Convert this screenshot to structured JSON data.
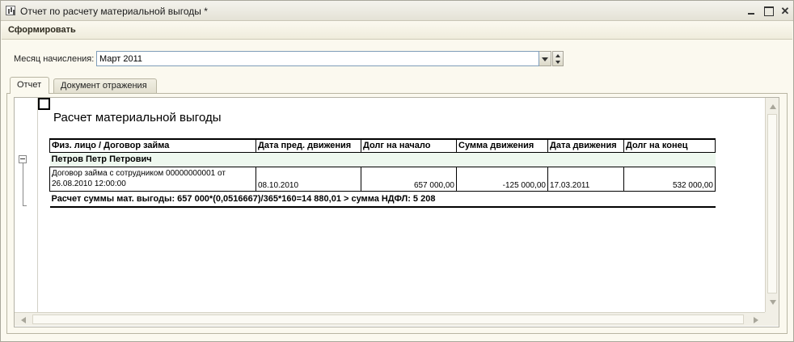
{
  "window": {
    "title": "Отчет по расчету материальной выгоды *"
  },
  "toolbar": {
    "generate_label": "Сформировать"
  },
  "filter": {
    "month_label": "Месяц начисления:",
    "month_value": "Март 2011"
  },
  "tabs": [
    {
      "label": "Отчет",
      "active": true
    },
    {
      "label": "Документ отражения",
      "active": false
    }
  ],
  "report": {
    "title": "Расчет материальной выгоды",
    "columns": [
      "Физ. лицо / Договор займа",
      "Дата пред. движения",
      "Долг на начало",
      "Сумма движения",
      "Дата движения",
      "Долг на конец"
    ],
    "person": "Петров Петр Петрович",
    "row": {
      "contract": "Договор займа с сотрудником 00000000001 от 26.08.2010 12:00:00",
      "prev_date": "08.10.2010",
      "debt_start": "657 000,00",
      "movement_sum": "-125 000,00",
      "movement_date": "17.03.2011",
      "debt_end": "532 000,00"
    },
    "calculation": "Расчет суммы мат. выгоды: 657 000*(0,0516667)/365*160=14 880,01 > сумма НДФЛ: 5 208"
  },
  "colors": {
    "window_bg": "#fbf9ef",
    "person_row_bg": "#eef8ef",
    "field_border": "#7f9db9"
  }
}
